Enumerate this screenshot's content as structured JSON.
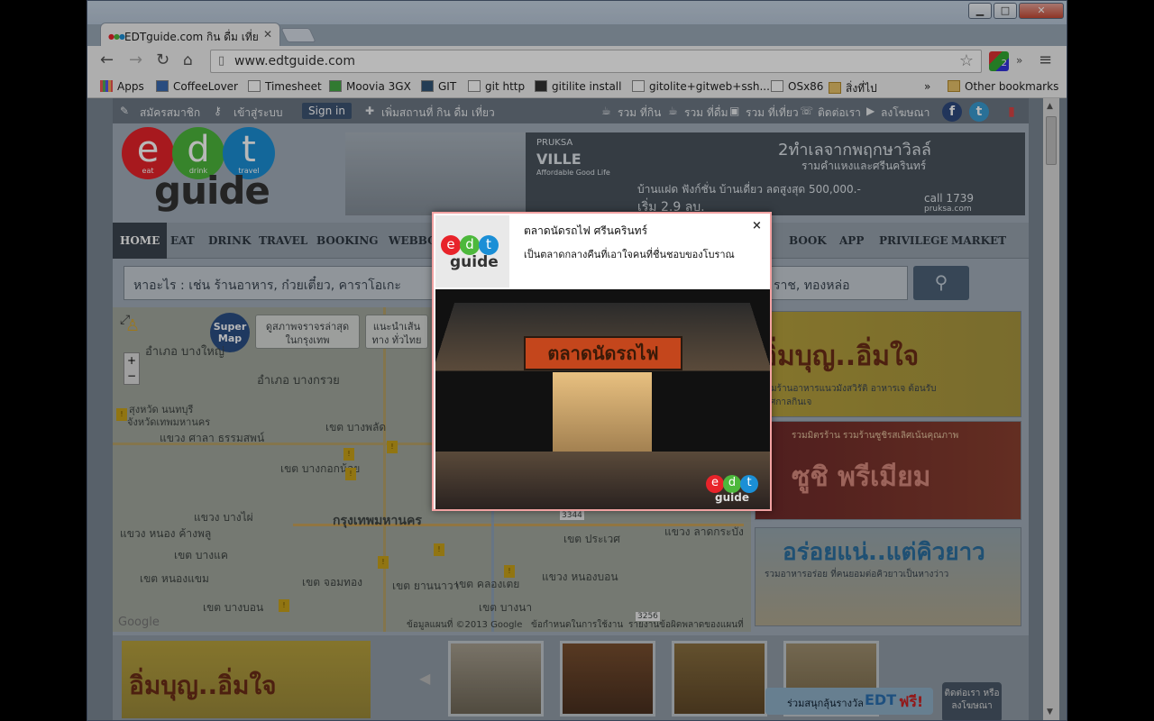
{
  "browser": {
    "tab_title": "EDTguide.com กิน ดื่ม เที่ย",
    "url": "www.edtguide.com",
    "window_controls": {
      "minimize": "▁",
      "maximize": "□",
      "close": "✕"
    },
    "extension_badge": "2",
    "bookmarks": [
      "Apps",
      "CoffeeLover",
      "Timesheet",
      "Moovia 3GX",
      "GIT",
      "git http",
      "gitilite install",
      "gitolite+gitweb+ssh...",
      "OSx86",
      "สิ่งที่ไป"
    ],
    "bookmarks_more": "»",
    "other_bookmarks": "Other bookmarks"
  },
  "site": {
    "topbar": {
      "register": "สมัครสมาชิก",
      "login": "เข้าสู่ระบบ",
      "signin": "Sign in",
      "add_place": "เพิ่มสถานที่ กิน ดื่ม เที่ยว",
      "eat": "รวม ที่กิน",
      "drink": "รวม ที่ดื่ม",
      "travel": "รวม ที่เที่ยว",
      "contact": "ติดต่อเรา",
      "advertise": "ลงโฆษณา"
    },
    "logo": {
      "e": "e",
      "d": "d",
      "t": "t",
      "eat": "eat",
      "drink": "drink",
      "travel": "travel",
      "guide": "guide"
    },
    "banner": {
      "brand": "PRUKSA",
      "brand2": "VILLE",
      "tagline": "Affordable Good Life",
      "headline": "2ทำเลจากพฤกษาวิลล์",
      "sub": "รามคำแหงและศรีนครินทร์",
      "offer": "บ้านแฝด ฟังก์ชั่น บ้านเดี่ยว ลดสูงสุด 500,000.-",
      "price": "เริ่ม 2.9 ลบ.",
      "call": "call 1739",
      "web": "pruksa.com"
    },
    "nav": [
      "HOME",
      "EAT",
      "DRINK",
      "TRAVEL",
      "BOOKING",
      "WEBBOA",
      "BOOK",
      "APP",
      "PRIVILEGE",
      "MARKET"
    ],
    "search": {
      "placeholder": "หาอะไร : เช่น ร้านอาหาร, ก๋วยเตี๋ยว, คาราโอเกะ",
      "placeholder_tail": "ราช, ทองหล่อ"
    },
    "map": {
      "super": "Super Map",
      "btn1": "ดูสภาพจราจรล่าสุด ในกรุงเทพ",
      "btn2": "แนะนำเส้นทาง ทั่วไทย",
      "labels": [
        "อำเภอ บางใหญ่",
        "อำเภอ บางกรวย",
        "สุงหวัด นนทบุรี",
        "จังหวัดเทพมหานคร",
        "แขวง ศาลา ธรรมสพน์",
        "เขต บางพลัด",
        "เขต บางกอกน้อย",
        "แขวง บางไผ่",
        "กรุงเทพมหานคร",
        "แขวง หนอง ค้างพลู",
        "เขต บางแค",
        "เขต หนองแขม",
        "เขต จอมทอง",
        "เขต ยานนาวา",
        "เขต บางบอน",
        "เขต ประเวศ",
        "เขต คลองเตย",
        "เขต บางนา",
        "แขวง หนองบอน",
        "แขวง ลาดกระบัง"
      ],
      "highway": "3344",
      "highway2": "3256",
      "copyright": "ข้อมูลแผนที่ ©2013 Google",
      "terms": "ข้อกำหนดในการใช้งาน",
      "report": "รายงานข้อผิดพลาดของแผนที่",
      "google": "Google"
    },
    "promos": [
      {
        "title": "อิ่มบุญ..อิ่มใจ",
        "sub": "รวมร้านอาหารแนวมังสวิรัติ อาหารเจ ต้อนรับเทศกาลกินเจ"
      },
      {
        "title": "ซูชิ พรีเมียม",
        "sub": "รวมมิตรร้าน รวมร้านซูชิรสเลิศเน้นคุณภาพ"
      },
      {
        "title": "อร่อยแน่..แต่คิวยาว",
        "sub": "รวมอาหารอร่อย ที่คนยอมต่อคิวยาวเป็นหางว่าว"
      }
    ],
    "strip": {
      "title": "อิ่มบุญ..อิ่มใจ"
    },
    "chat": {
      "join": "ร่วมสนุกลุ้นรางวัล",
      "edt": "EDT",
      "free": "ฟรี!",
      "contact": "ติดต่อเรา หรือลงโฆษณา"
    }
  },
  "popup": {
    "title": "ตลาดนัดรถไฟ ศรีนครินทร์",
    "subtitle": "เป็นตลาดกลางคืนที่เอาใจคนที่ชื่นชอบของโบราณ",
    "close": "×",
    "sign_text": "ตลาดนัดรถไฟ"
  },
  "colors": {
    "e": "#e8232a",
    "d": "#4db83c",
    "t": "#1b8fd6",
    "accent": "#3e5574"
  }
}
